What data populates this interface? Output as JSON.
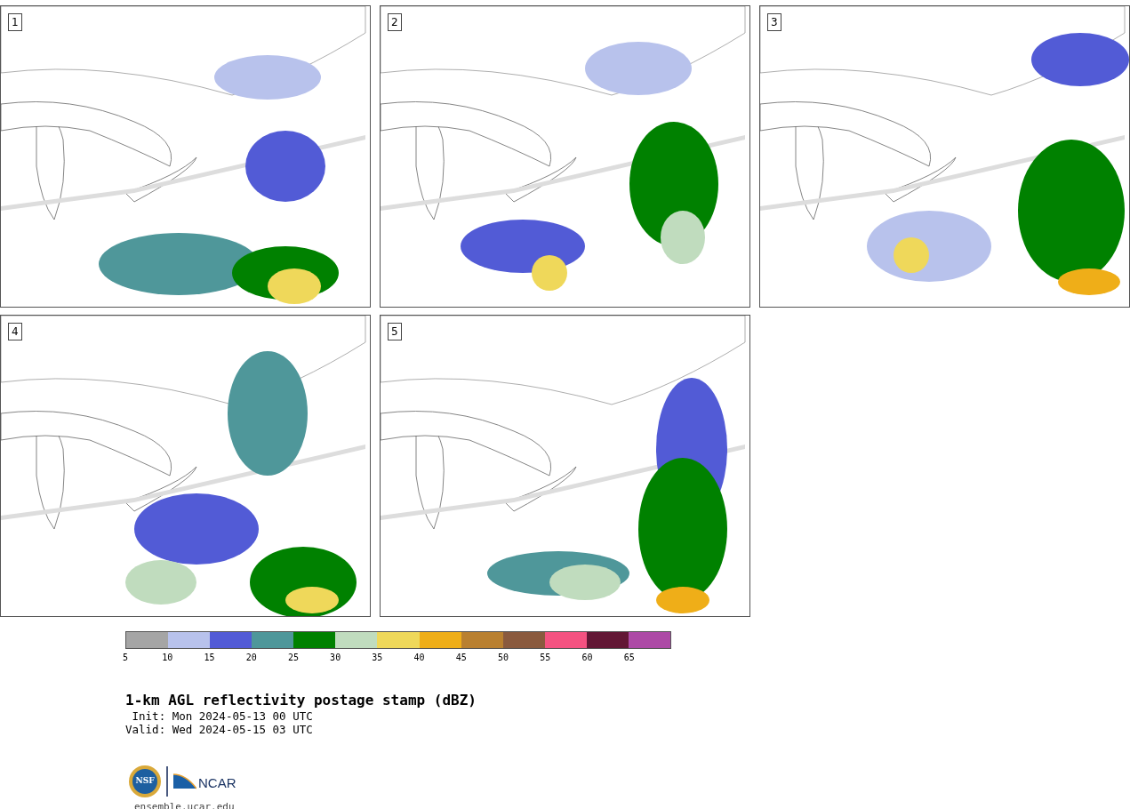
{
  "panels": [
    {
      "label": "1"
    },
    {
      "label": "2"
    },
    {
      "label": "3"
    },
    {
      "label": "4"
    },
    {
      "label": "5"
    }
  ],
  "colorbar": {
    "segments": [
      {
        "label": "5",
        "color": "#a5a5a5"
      },
      {
        "label": "10",
        "color": "#b8c2ec"
      },
      {
        "label": "15",
        "color": "#525bd6"
      },
      {
        "label": "20",
        "color": "#4f979a"
      },
      {
        "label": "25",
        "color": "#008100"
      },
      {
        "label": "30",
        "color": "#c0dcbe"
      },
      {
        "label": "35",
        "color": "#efd85a"
      },
      {
        "label": "40",
        "color": "#efae18"
      },
      {
        "label": "45",
        "color": "#b98030"
      },
      {
        "label": "50",
        "color": "#8a5a3e"
      },
      {
        "label": "55",
        "color": "#f45281"
      },
      {
        "label": "60",
        "color": "#621735"
      },
      {
        "label": "65",
        "color": "#ad4aa6"
      }
    ]
  },
  "title": "1-km AGL reflectivity postage stamp (dBZ)",
  "init": " Init: Mon 2024-05-13 00 UTC",
  "valid": "Valid: Wed 2024-05-15 03 UTC",
  "logo": {
    "nsf": "NSF",
    "ncar": "NCAR"
  },
  "url": "ensemble.ucar.edu"
}
